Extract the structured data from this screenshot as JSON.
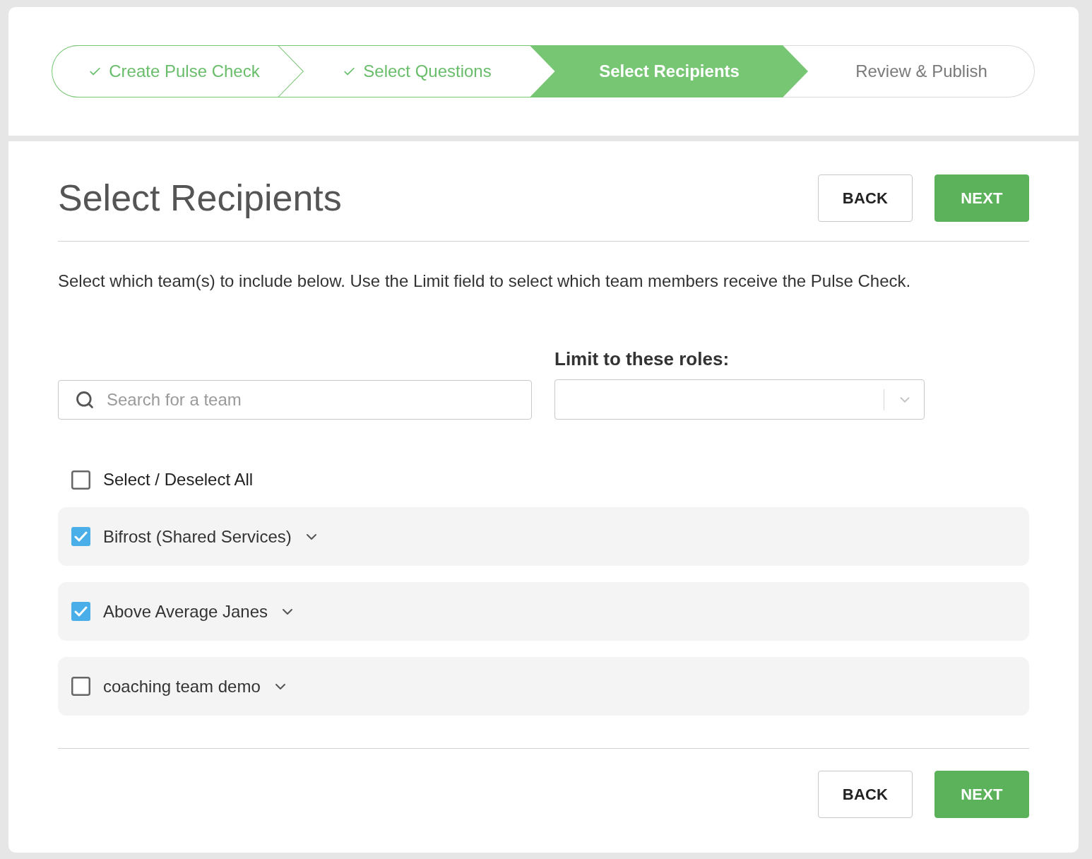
{
  "steps": [
    {
      "label": "Create Pulse Check",
      "completed": true,
      "selected": false
    },
    {
      "label": "Select Questions",
      "completed": true,
      "selected": false
    },
    {
      "label": "Select Recipients",
      "completed": false,
      "selected": true
    },
    {
      "label": "Review & Publish",
      "completed": false,
      "selected": false
    }
  ],
  "page": {
    "title": "Select Recipients",
    "description": "Select which team(s) to include below. Use the Limit field to select which team members receive the Pulse Check."
  },
  "header_buttons": [
    {
      "label": "BACK",
      "kind": "secondary"
    },
    {
      "label": "NEXT",
      "kind": "primary"
    }
  ],
  "search": {
    "placeholder": "Search for a team"
  },
  "roles_filter": {
    "label": "Limit to these roles:"
  },
  "select_all": {
    "label": "Select / Deselect All",
    "checked": false
  },
  "teams": [
    {
      "name": "Bifrost (Shared Services)",
      "checked": true
    },
    {
      "name": "Above Average Janes",
      "checked": true
    },
    {
      "name": "coaching team demo",
      "checked": false
    }
  ],
  "footer_buttons": [
    {
      "label": "BACK",
      "kind": "secondary"
    },
    {
      "label": "NEXT",
      "kind": "primary"
    }
  ]
}
